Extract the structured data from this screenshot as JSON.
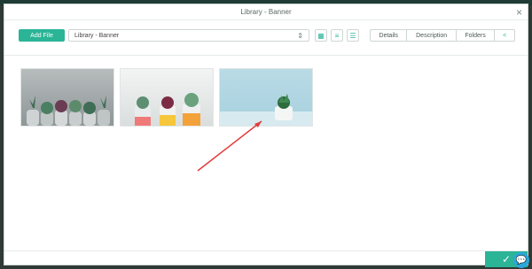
{
  "modal": {
    "title": "Library - Banner"
  },
  "toolbar": {
    "add_file_label": "Add File",
    "selected_library": "Library - Banner",
    "view_icons": [
      "grid-icon",
      "list-icon",
      "details-icon"
    ],
    "tabs": [
      {
        "label": "Details"
      },
      {
        "label": "Description"
      },
      {
        "label": "Folders"
      },
      {
        "label": "<"
      }
    ]
  },
  "thumbnails": [
    {
      "name": "succulents-gray-pots"
    },
    {
      "name": "succulents-colorful-pots"
    },
    {
      "name": "succulent-blue-background"
    }
  ],
  "colors": {
    "accent": "#2bb496",
    "chat": "#2aa7d9",
    "arrow": "#e23b3b"
  },
  "footer": {
    "confirm_icon": "check-icon",
    "chat_icon": "chat-icon"
  }
}
